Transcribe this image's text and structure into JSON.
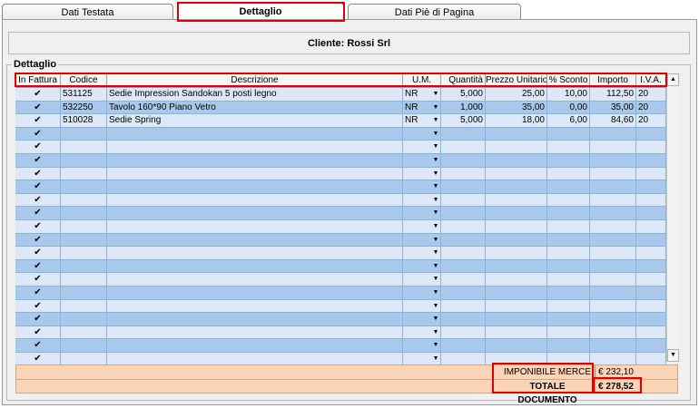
{
  "tabs": [
    {
      "label": "Dati Testata",
      "active": false
    },
    {
      "label": "Dettaglio",
      "active": true
    },
    {
      "label": "Dati Piè di Pagina",
      "active": false
    }
  ],
  "cliente_label": "Cliente: Rossi Srl",
  "group_title": "Dettaglio",
  "columns": [
    "In Fattura",
    "Codice",
    "Descrizione",
    "U.M.",
    "Quantità",
    "Prezzo Unitario",
    "% Sconto",
    "Importo",
    "I.V.A."
  ],
  "rows": [
    {
      "in_fattura": true,
      "codice": "531125",
      "descrizione": "Sedie Impression Sandokan 5 posti legno",
      "um": "NR",
      "quantita": "5,000",
      "prezzo": "25,00",
      "sconto": "10,00",
      "importo": "112,50",
      "iva": "20"
    },
    {
      "in_fattura": true,
      "codice": "532250",
      "descrizione": "Tavolo 160*90 Piano Vetro",
      "um": "NR",
      "quantita": "1,000",
      "prezzo": "35,00",
      "sconto": "0,00",
      "importo": "35,00",
      "iva": "20"
    },
    {
      "in_fattura": true,
      "codice": "510028",
      "descrizione": "Sedie Spring",
      "um": "NR",
      "quantita": "5,000",
      "prezzo": "18,00",
      "sconto": "6,00",
      "importo": "84,60",
      "iva": "20"
    }
  ],
  "empty_row_count": 18,
  "icons": {
    "checkbox": "check-icon",
    "dropdown": "dropdown-arrow-icon",
    "scroll_up": "scroll-up-icon",
    "scroll_down": "scroll-down-icon"
  },
  "colors": {
    "row_light": "#dce8f7",
    "row_dark": "#a9c9ec",
    "totals_bg": "#fad4b4",
    "highlight": "#e00000"
  },
  "totals": {
    "imponibile_label": "IMPONIBILE MERCE",
    "imponibile_value": "€ 232,10",
    "totale_label": "TOTALE DOCUMENTO",
    "totale_value": "€ 278,52"
  }
}
